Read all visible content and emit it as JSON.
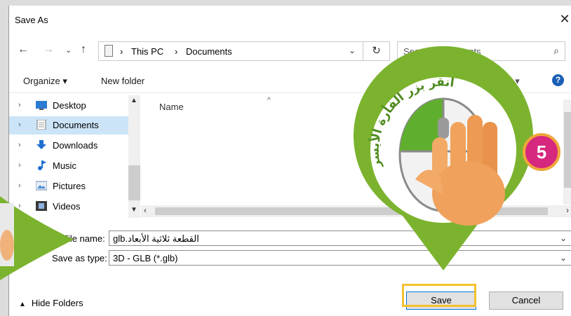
{
  "dialog": {
    "title": "Save As",
    "close_glyph": "✕"
  },
  "address_bar": {
    "crumbs": [
      "This PC",
      "Documents"
    ],
    "separator": "›",
    "refresh_glyph": "↻"
  },
  "search": {
    "placeholder": "Search Documents"
  },
  "toolbar": {
    "organize_label": "Organize ▾",
    "new_folder_label": "New folder",
    "view_label": "☷ ▾",
    "help_label": "?"
  },
  "tree": {
    "items": [
      {
        "label": "Desktop",
        "icon": "desktop-icon"
      },
      {
        "label": "Documents",
        "icon": "documents-icon",
        "selected": true
      },
      {
        "label": "Downloads",
        "icon": "downloads-icon"
      },
      {
        "label": "Music",
        "icon": "music-icon"
      },
      {
        "label": "Pictures",
        "icon": "pictures-icon"
      },
      {
        "label": "Videos",
        "icon": "videos-icon"
      }
    ]
  },
  "file_list": {
    "column_name": "Name"
  },
  "form": {
    "file_name_label": "File name:",
    "file_name_value": "القطعة ثلاثية الأبعاد.glb",
    "save_type_label": "Save as type:",
    "save_type_value": "3D - GLB (*.glb)"
  },
  "footer": {
    "hide_folders_label": "Hide Folders",
    "save_label": "Save",
    "cancel_label": "Cancel"
  },
  "annotation": {
    "callout_text": "انقر بزر الفأرة الأيسر",
    "step_number": "5"
  },
  "colors": {
    "accent_green": "#7cb32e",
    "badge_magenta": "#d6287e",
    "badge_ring": "#f0a63a",
    "highlight_yellow": "#f2c12e",
    "selection_blue": "#cce4f7"
  }
}
